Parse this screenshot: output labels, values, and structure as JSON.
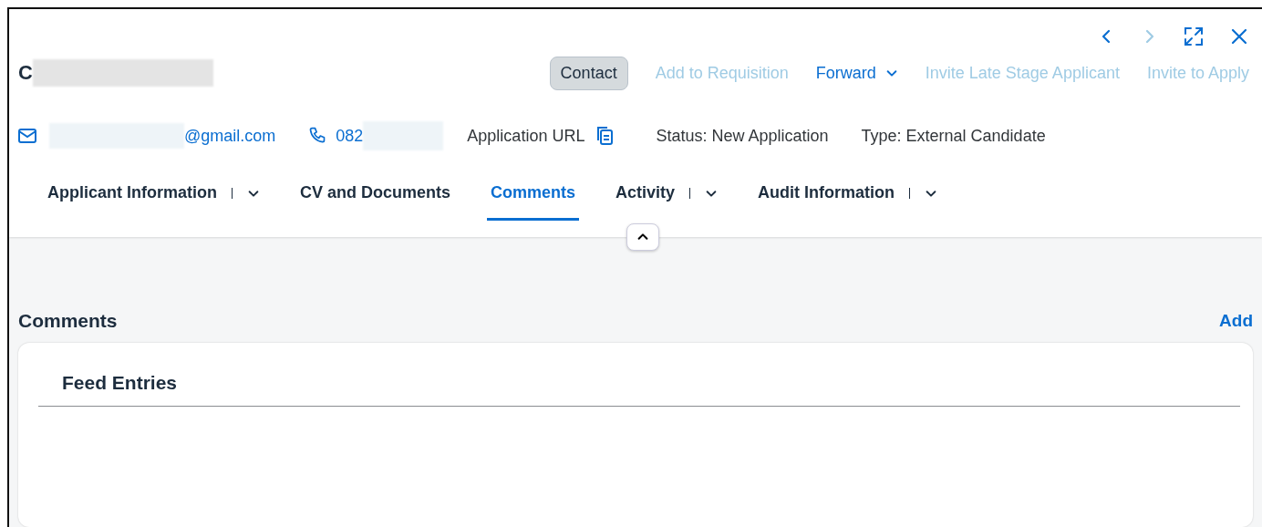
{
  "header": {
    "name": "C",
    "email": "@gmail.com",
    "phone": "082",
    "application_url": "Application URL",
    "status": "Status: New Application",
    "type": "Type: External Candidate"
  },
  "actions": [
    {
      "label": "Contact",
      "kind": "pill",
      "disabled": false
    },
    {
      "label": "Add to Requisition",
      "kind": "link",
      "disabled": true
    },
    {
      "label": "Forward",
      "kind": "menu",
      "disabled": false
    },
    {
      "label": "Invite Late Stage Applicant",
      "kind": "link",
      "disabled": true
    },
    {
      "label": "Invite to Apply",
      "kind": "link",
      "disabled": true
    }
  ],
  "nav": {
    "previous_disabled": false,
    "next_disabled": true
  },
  "tabs": [
    {
      "label": "Applicant Information",
      "selected": false,
      "has_menu": true
    },
    {
      "label": "CV and Documents",
      "selected": false,
      "has_menu": false
    },
    {
      "label": "Comments",
      "selected": true,
      "has_menu": false
    },
    {
      "label": "Activity",
      "selected": false,
      "has_menu": true
    },
    {
      "label": "Audit Information",
      "selected": false,
      "has_menu": true
    }
  ],
  "section": {
    "title": "Comments",
    "add_label": "Add",
    "card_title": "Feed Entries"
  }
}
